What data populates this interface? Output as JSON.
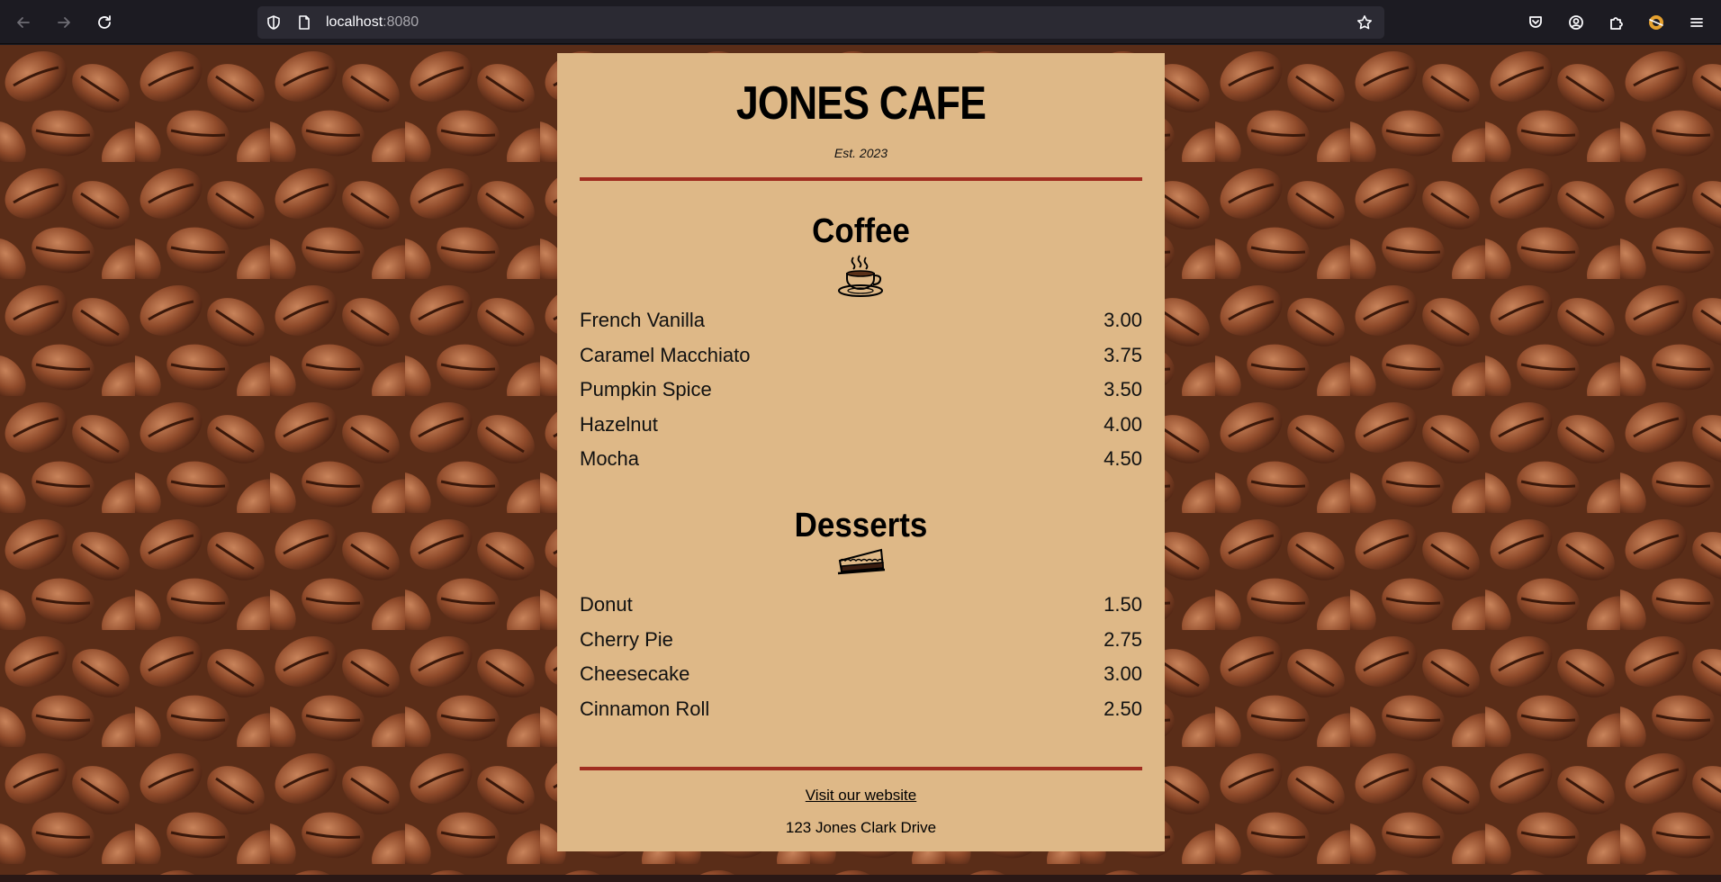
{
  "browser": {
    "url_host": "localhost",
    "url_port": ":8080"
  },
  "cafe": {
    "title": "JONES CAFE",
    "established": "Est. 2023"
  },
  "coffee": {
    "heading": "Coffee",
    "items": [
      {
        "name": "French Vanilla",
        "price": "3.00"
      },
      {
        "name": "Caramel Macchiato",
        "price": "3.75"
      },
      {
        "name": "Pumpkin Spice",
        "price": "3.50"
      },
      {
        "name": "Hazelnut",
        "price": "4.00"
      },
      {
        "name": "Mocha",
        "price": "4.50"
      }
    ]
  },
  "desserts": {
    "heading": "Desserts",
    "items": [
      {
        "name": "Donut",
        "price": "1.50"
      },
      {
        "name": "Cherry Pie",
        "price": "2.75"
      },
      {
        "name": "Cheesecake",
        "price": "3.00"
      },
      {
        "name": "Cinnamon Roll",
        "price": "2.50"
      }
    ]
  },
  "footer": {
    "link_text": "Visit our website",
    "address": "123 Jones Clark Drive"
  },
  "colors": {
    "card_background": "#deb887",
    "rule": "#a02d20",
    "browser_toolbar": "#1c1b22"
  }
}
